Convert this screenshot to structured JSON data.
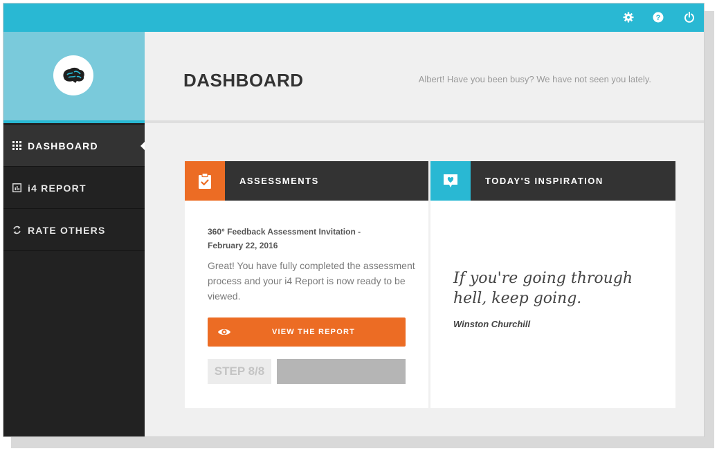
{
  "topbar": {
    "icons": [
      "gear-icon",
      "help-icon",
      "power-icon"
    ],
    "color": "#29b8d3"
  },
  "sidebar": {
    "logo": "brain-logo",
    "items": [
      {
        "label": "DASHBOARD",
        "icon": "grid-icon",
        "active": true
      },
      {
        "label": "i4 REPORT",
        "icon": "report-icon",
        "active": false
      },
      {
        "label": "RATE OTHERS",
        "icon": "refresh-icon",
        "active": false
      }
    ]
  },
  "header": {
    "title": "DASHBOARD",
    "greeting": "Albert! Have you been busy? We have not seen you lately."
  },
  "assessments": {
    "title": "ASSESSMENTS",
    "icon": "clipboard-check-icon",
    "accent": "#ec6c24",
    "item_title": "360° Feedback Assessment Invitation - February 22, 2016",
    "body": "Great! You have fully completed the assessment process and your i4 Report is now ready to be viewed.",
    "button_label": "VIEW THE REPORT",
    "step_label": "STEP 8/8",
    "progress": 1.0
  },
  "inspiration": {
    "title": "TODAY'S INSPIRATION",
    "icon": "heart-chat-icon",
    "accent": "#29b8d3",
    "quote": "If you're going through hell, keep going.",
    "author": "Winston Churchill"
  }
}
